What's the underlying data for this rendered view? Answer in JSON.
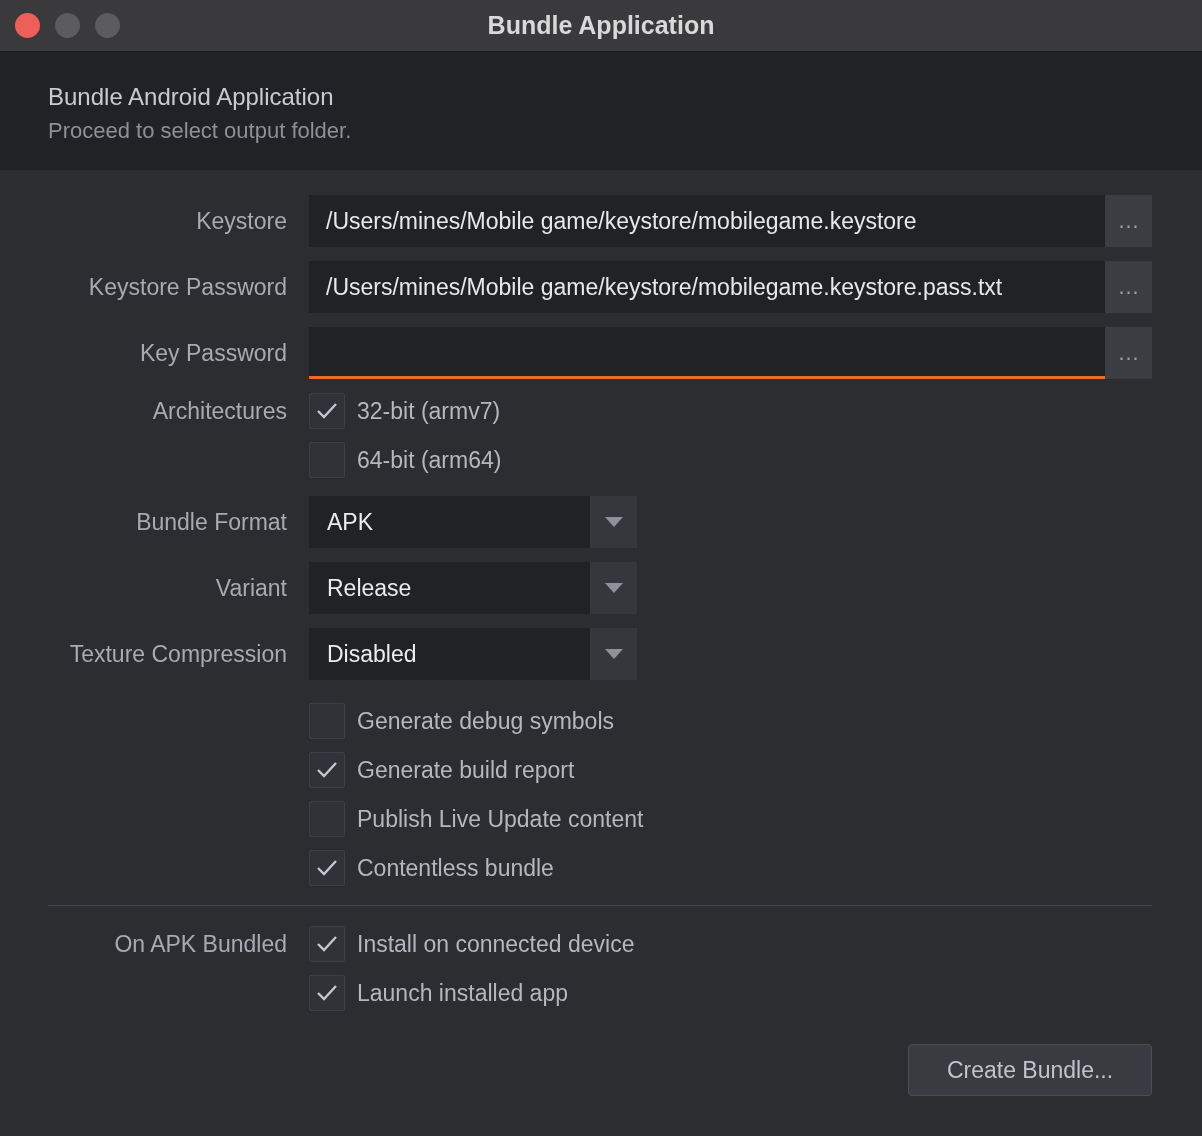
{
  "window": {
    "title": "Bundle Application"
  },
  "header": {
    "title": "Bundle Android Application",
    "subtitle": "Proceed to select output folder."
  },
  "fields": [
    {
      "label": "Keystore",
      "value": "/Users/mines/Mobile game/keystore/mobilegame.keystore",
      "button": "…",
      "focused": false
    },
    {
      "label": "Keystore Password",
      "value": "/Users/mines/Mobile game/keystore/mobilegame.keystore.pass.txt",
      "button": "…",
      "focused": false
    },
    {
      "label": "Key Password",
      "button": "…",
      "focused": true
    }
  ],
  "architectures": {
    "label": "Architectures",
    "options": [
      {
        "label": "32-bit (armv7)",
        "checked": true
      },
      {
        "label": "64-bit (arm64)",
        "checked": false
      }
    ]
  },
  "selects": [
    {
      "label": "Bundle Format",
      "value": "APK"
    },
    {
      "label": "Variant",
      "value": "Release"
    },
    {
      "label": "Texture Compression",
      "value": "Disabled"
    }
  ],
  "options": [
    {
      "label": "Generate debug symbols",
      "checked": false
    },
    {
      "label": "Generate build report",
      "checked": true
    },
    {
      "label": "Publish Live Update content",
      "checked": false
    },
    {
      "label": "Contentless bundle",
      "checked": true
    }
  ],
  "on_bundled": {
    "label": "On APK Bundled",
    "options": [
      {
        "label": "Install on connected device",
        "checked": true
      },
      {
        "label": "Launch installed app",
        "checked": true
      }
    ]
  },
  "buttons": [
    {
      "label": "Create Bundle..."
    }
  ]
}
